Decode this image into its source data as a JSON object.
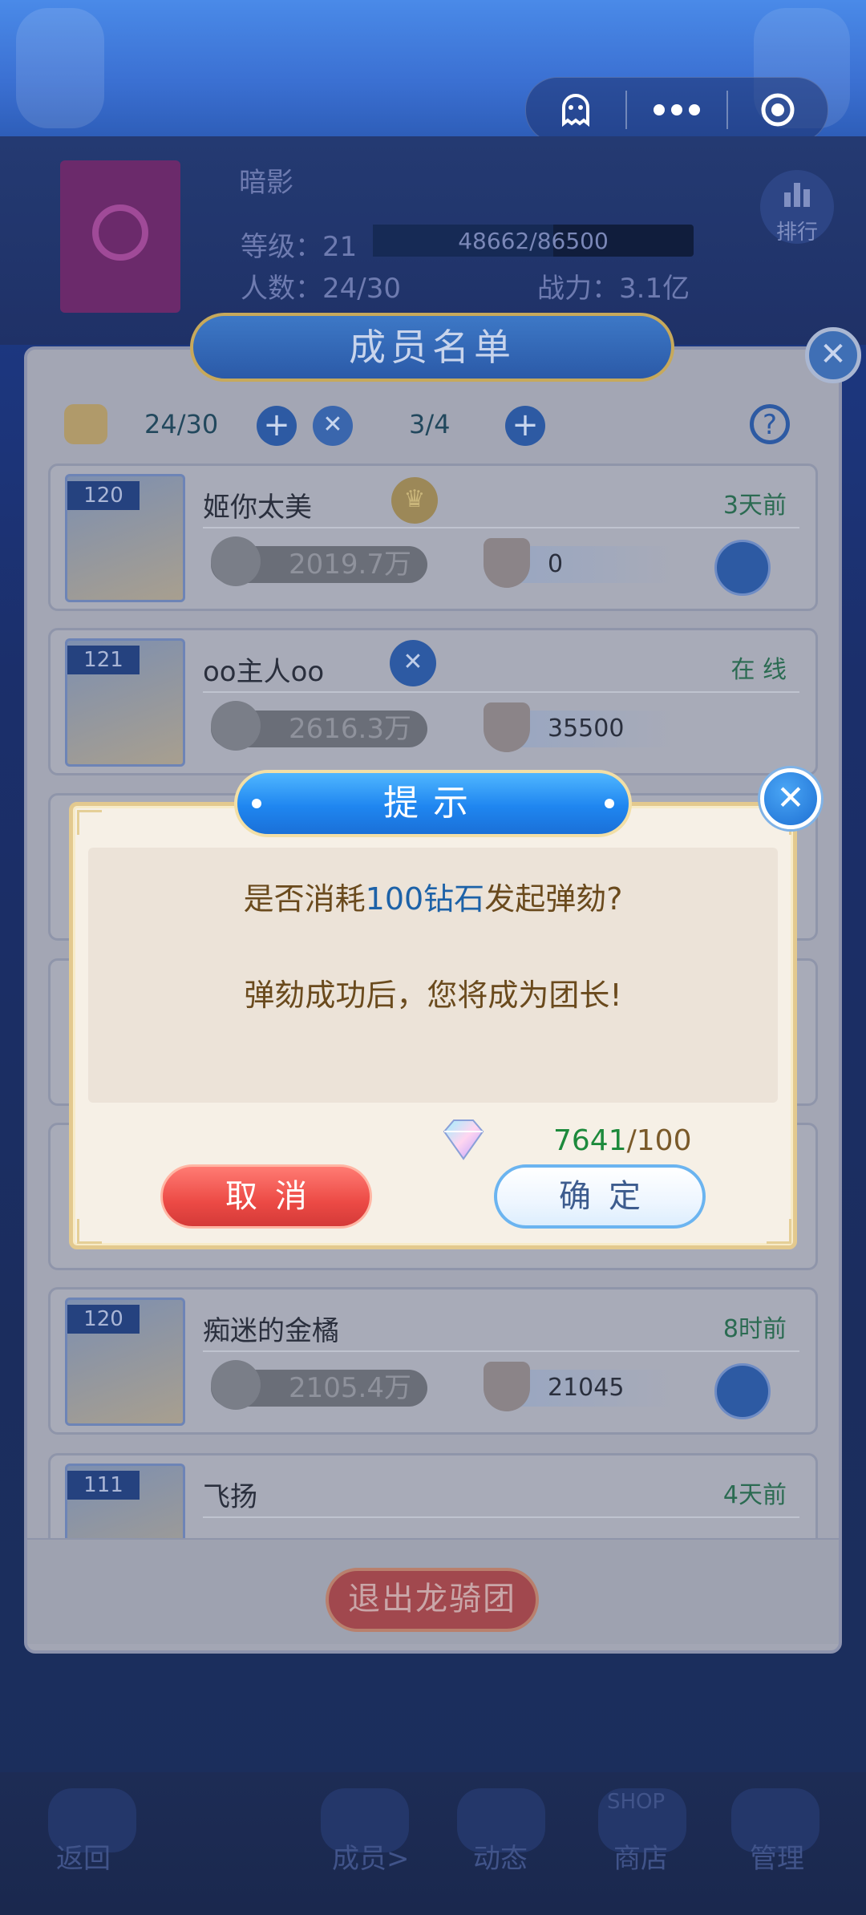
{
  "capsule": {
    "left_icon": "ghost-icon",
    "middle_icon": "more-dots-icon",
    "right_icon": "target-icon"
  },
  "guild": {
    "name": "暗影",
    "level_label": "等级：21",
    "exp": "48662/86500",
    "exp_progress": 0.5626,
    "members_label": "人数：24/30",
    "power_label": "战力：3.1亿",
    "rank_label": "排行"
  },
  "panel": {
    "title": "成员名单",
    "members_count": "24/30",
    "warriors_count": "3/4",
    "exit_label": "退出龙骑团"
  },
  "members": [
    {
      "level": "120",
      "name": "姬你太美",
      "time": "3天前",
      "power": "2019.7万",
      "contribution": "0",
      "badge": "crown"
    },
    {
      "level": "121",
      "name": "oo主人oo",
      "time": "在 线",
      "power": "2616.3万",
      "contribution": "35500",
      "badge": "swords"
    },
    {
      "level": "120",
      "name": "痴迷的金橘",
      "time": "8时前",
      "power": "2105.4万",
      "contribution": "21045",
      "badge": ""
    },
    {
      "level": "111",
      "name": "飞扬",
      "time": "4天前",
      "power": "",
      "contribution": "",
      "badge": ""
    }
  ],
  "nav": {
    "back": "返回",
    "members": "成员>",
    "activity": "动态",
    "shop": "商店",
    "shop_sign": "SHOP",
    "manage": "管理"
  },
  "dialog": {
    "title": "提示",
    "line1_prefix": "是否消耗",
    "line1_highlight": "100钻石",
    "line1_suffix": "发起弹劾?",
    "line2": "弹劾成功后，您将成为团长!",
    "have": "7641",
    "cost": "/100",
    "cancel": "取消",
    "confirm": "确定"
  },
  "colors": {
    "dialog_title": "#1f86f0",
    "cancel": "#ec4a45",
    "confirm_border": "#6bb4f0",
    "highlight": "#1d62a8",
    "have": "#1d8a3c"
  }
}
